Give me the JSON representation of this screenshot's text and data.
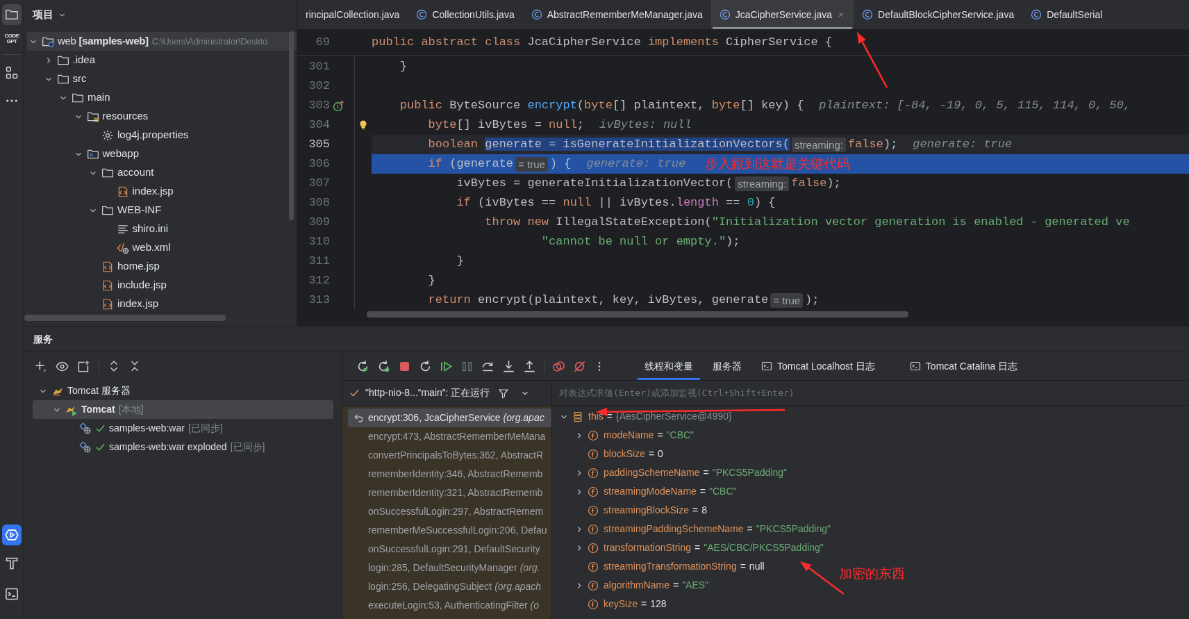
{
  "project": {
    "title": "项目",
    "tree": [
      {
        "label": "web **[samples-web]**",
        "path": "C:\\Users\\Administrator\\Deskto",
        "kind": "module",
        "expanded": true,
        "selected": true,
        "children": [
          {
            "label": ".idea",
            "kind": "folder",
            "expanded": false,
            "selected": false
          },
          {
            "label": "src",
            "kind": "folder",
            "expanded": true,
            "selected": false,
            "children": [
              {
                "label": "main",
                "kind": "folder",
                "expanded": true,
                "selected": false,
                "children": [
                  {
                    "label": "resources",
                    "kind": "resources",
                    "expanded": true,
                    "selected": false,
                    "children": [
                      {
                        "label": "log4j.properties",
                        "kind": "properties",
                        "selected": false
                      }
                    ]
                  },
                  {
                    "label": "webapp",
                    "kind": "webapp",
                    "expanded": true,
                    "selected": false,
                    "children": [
                      {
                        "label": "account",
                        "kind": "folder",
                        "expanded": true,
                        "selected": false,
                        "children": [
                          {
                            "label": "index.jsp",
                            "kind": "jsp",
                            "selected": false
                          }
                        ]
                      },
                      {
                        "label": "WEB-INF",
                        "kind": "folder",
                        "expanded": true,
                        "selected": false,
                        "children": [
                          {
                            "label": "shiro.ini",
                            "kind": "text",
                            "selected": false
                          },
                          {
                            "label": "web.xml",
                            "kind": "xml",
                            "selected": false
                          }
                        ]
                      },
                      {
                        "label": "home.jsp",
                        "kind": "jsp",
                        "selected": false
                      },
                      {
                        "label": "include.jsp",
                        "kind": "jsp",
                        "selected": false
                      },
                      {
                        "label": "index.jsp",
                        "kind": "jsp",
                        "selected": false
                      }
                    ]
                  }
                ]
              }
            ]
          }
        ]
      }
    ]
  },
  "editor": {
    "tabs": [
      {
        "label": "rincipalCollection.java",
        "icon": false,
        "selected": false
      },
      {
        "label": "CollectionUtils.java",
        "icon": true,
        "selected": false
      },
      {
        "label": "AbstractRememberMeManager.java",
        "icon": true,
        "selected": false
      },
      {
        "label": "JcaCipherService.java",
        "icon": true,
        "selected": true
      },
      {
        "label": "DefaultBlockCipherService.java",
        "icon": true,
        "selected": false
      },
      {
        "label": "DefaultSerial",
        "icon": true,
        "selected": false
      }
    ],
    "sticky_line": {
      "number": "69",
      "tokens": [
        {
          "kind": "kw",
          "text": "public abstract class "
        },
        {
          "kind": "plain",
          "text": "JcaCipherService "
        },
        {
          "kind": "kw",
          "text": "implements "
        },
        {
          "kind": "plain",
          "text": "CipherService {"
        }
      ]
    },
    "lines": [
      {
        "number": "301",
        "kind": "plain",
        "caret": false,
        "execution_point": false,
        "tokens": [
          {
            "kind": "plain",
            "text": "    }"
          }
        ]
      },
      {
        "number": "302",
        "kind": "plain",
        "caret": false,
        "execution_point": false
      },
      {
        "number": "303",
        "kind": "override",
        "caret": false,
        "execution_point": false,
        "tokens": [
          {
            "kind": "kw",
            "text": "    public "
          },
          {
            "kind": "plain",
            "text": "ByteSource "
          },
          {
            "kind": "method",
            "text": "encrypt"
          },
          {
            "kind": "plain",
            "text": "("
          },
          {
            "kind": "kw",
            "text": "byte"
          },
          {
            "kind": "plain",
            "text": "[] plaintext, "
          },
          {
            "kind": "kw",
            "text": "byte"
          },
          {
            "kind": "plain",
            "text": "[] key) {"
          },
          {
            "kind": "hint",
            "text": "plaintext: [-84, -19, 0, 5, 115, 114, 0, 50,"
          }
        ]
      },
      {
        "number": "304",
        "kind": "bulb",
        "caret": false,
        "execution_point": false,
        "tokens": [
          {
            "kind": "kw",
            "text": "        byte"
          },
          {
            "kind": "plain",
            "text": "[] ivBytes = "
          },
          {
            "kind": "kw",
            "text": "null"
          },
          {
            "kind": "plain",
            "text": ";"
          },
          {
            "kind": "hint",
            "text": "ivBytes: null"
          }
        ]
      },
      {
        "number": "305",
        "kind": "plain",
        "caret": true,
        "execution_point": false,
        "tokens": [
          {
            "kind": "kw",
            "text": "        boolean "
          },
          {
            "kind": "selected",
            "text": "generate = isGenerateInitializationVectors("
          },
          {
            "kind": "inlay",
            "text": "streaming:"
          },
          {
            "kind": "kw",
            "text": "false"
          },
          {
            "kind": "plain",
            "text": ");"
          },
          {
            "kind": "hint",
            "text": "generate: true"
          }
        ]
      },
      {
        "number": "306",
        "kind": "plain",
        "caret": false,
        "execution_point": true,
        "tokens": [
          {
            "kind": "kw",
            "text": "        if "
          },
          {
            "kind": "plain",
            "text": "(generate"
          },
          {
            "kind": "inlay",
            "text": "= true"
          },
          {
            "kind": "plain",
            "text": ") {"
          },
          {
            "kind": "hint",
            "text": "generate: true"
          },
          {
            "kind": "annotation",
            "text": "步入跟到这就是关键代码"
          }
        ]
      },
      {
        "number": "307",
        "kind": "plain",
        "caret": false,
        "execution_point": false,
        "tokens": [
          {
            "kind": "plain",
            "text": "            ivBytes = generateInitializationVector("
          },
          {
            "kind": "inlay",
            "text": "streaming:"
          },
          {
            "kind": "kw",
            "text": "false"
          },
          {
            "kind": "plain",
            "text": ");"
          }
        ]
      },
      {
        "number": "308",
        "kind": "plain",
        "caret": false,
        "execution_point": false,
        "tokens": [
          {
            "kind": "kw",
            "text": "            if "
          },
          {
            "kind": "plain",
            "text": "(ivBytes == "
          },
          {
            "kind": "kw",
            "text": "null"
          },
          {
            "kind": "plain",
            "text": " || ivBytes."
          },
          {
            "kind": "field",
            "text": "length"
          },
          {
            "kind": "plain",
            "text": " == "
          },
          {
            "kind": "number",
            "text": "0"
          },
          {
            "kind": "plain",
            "text": ") {"
          }
        ]
      },
      {
        "number": "309",
        "kind": "plain",
        "caret": false,
        "execution_point": false,
        "tokens": [
          {
            "kind": "kw",
            "text": "                throw new "
          },
          {
            "kind": "plain",
            "text": "IllegalStateException("
          },
          {
            "kind": "string",
            "text": "\"Initialization vector generation is enabled - generated ve"
          }
        ]
      },
      {
        "number": "310",
        "kind": "plain",
        "caret": false,
        "execution_point": false,
        "tokens": [
          {
            "kind": "string",
            "text": "                        \"cannot be null or empty.\""
          },
          {
            "kind": "plain",
            "text": ");"
          }
        ]
      },
      {
        "number": "311",
        "kind": "plain",
        "caret": false,
        "execution_point": false,
        "tokens": [
          {
            "kind": "plain",
            "text": "            }"
          }
        ]
      },
      {
        "number": "312",
        "kind": "plain",
        "caret": false,
        "execution_point": false,
        "tokens": [
          {
            "kind": "plain",
            "text": "        }"
          }
        ]
      },
      {
        "number": "313",
        "kind": "plain",
        "caret": false,
        "execution_point": false,
        "tokens": [
          {
            "kind": "kw",
            "text": "        return "
          },
          {
            "kind": "plain",
            "text": "encrypt(plaintext, key, ivBytes, generate"
          },
          {
            "kind": "inlay",
            "text": "= true"
          },
          {
            "kind": "plain",
            "text": ");"
          }
        ]
      }
    ]
  },
  "services": {
    "title": "服务",
    "tree": [
      {
        "label": "Tomcat 服务器",
        "kind": "server",
        "expanded": true,
        "selected": false,
        "children": [
          {
            "label": "Tomcat",
            "note": "[本地]",
            "kind": "server_running",
            "expanded": true,
            "selected": true,
            "children": [
              {
                "label": "samples-web:war",
                "note": "[已同步]",
                "kind": "artifact",
                "selected": false
              },
              {
                "label": "samples-web:war exploded",
                "note": "[已同步]",
                "kind": "artifact",
                "selected": false
              }
            ]
          }
        ]
      }
    ]
  },
  "debugger": {
    "tabs": [
      {
        "label": "线程和变量",
        "icon": false,
        "selected": true
      },
      {
        "label": "服务器",
        "icon": false,
        "selected": false
      },
      {
        "label": "Tomcat Localhost 日志",
        "icon": true,
        "selected": false
      },
      {
        "label": "Tomcat Catalina 日志",
        "icon": true,
        "selected": false
      }
    ],
    "thread": "\"http-nio-8...“main”: 正在运行",
    "frames": [
      {
        "text": "encrypt:306, JcaCipherService *(org.apac*",
        "current": true,
        "selected": true
      },
      {
        "text": "encrypt:473, AbstractRememberMeMana",
        "current": false,
        "selected": false
      },
      {
        "text": "convertPrincipalsToBytes:362, AbstractR",
        "current": false,
        "selected": false
      },
      {
        "text": "rememberIdentity:346, AbstractRememb",
        "current": false,
        "selected": false
      },
      {
        "text": "rememberIdentity:321, AbstractRememb",
        "current": false,
        "selected": false
      },
      {
        "text": "onSuccessfulLogin:297, AbstractRemem",
        "current": false,
        "selected": false
      },
      {
        "text": "rememberMeSuccessfulLogin:206, Defau",
        "current": false,
        "selected": false
      },
      {
        "text": "onSuccessfulLogin:291, DefaultSecurity",
        "current": false,
        "selected": false
      },
      {
        "text": "login:285, DefaultSecurityManager *(org.*",
        "current": false,
        "selected": false
      },
      {
        "text": "login:256, DelegatingSubject *(org.apach*",
        "current": false,
        "selected": false
      },
      {
        "text": "executeLogin:53, AuthenticatingFilter *(o*",
        "current": false,
        "selected": false
      }
    ],
    "eval_placeholder": "对表达式求值(Enter)或添加监视(Ctrl+Shift+Enter)",
    "variables": [
      {
        "name": "this",
        "sign": "=",
        "value": "{AesCipherService@4990}",
        "kind": "object",
        "expanded": true,
        "children": [
          {
            "name": "modeName",
            "sign": "=",
            "value": "\"CBC\"",
            "kind": "string_field",
            "expanded": false
          },
          {
            "name": "blockSize",
            "sign": "=",
            "value": "0",
            "kind": "value_field"
          },
          {
            "name": "paddingSchemeName",
            "sign": "=",
            "value": "\"PKCS5Padding\"",
            "kind": "string_field",
            "expanded": false
          },
          {
            "name": "streamingModeName",
            "sign": "=",
            "value": "\"CBC\"",
            "kind": "string_field",
            "expanded": false
          },
          {
            "name": "streamingBlockSize",
            "sign": "=",
            "value": "8",
            "kind": "value_field"
          },
          {
            "name": "streamingPaddingSchemeName",
            "sign": "=",
            "value": "\"PKCS5Padding\"",
            "kind": "string_field",
            "expanded": false
          },
          {
            "name": "transformationString",
            "sign": "=",
            "value": "\"AES/CBC/PKCS5Padding\"",
            "kind": "string_field",
            "expanded": false
          },
          {
            "name": "streamingTransformationString",
            "sign": "=",
            "value": "null",
            "kind": "value_field"
          },
          {
            "name": "algorithmName",
            "sign": "=",
            "value": "\"AES\"",
            "kind": "string_field",
            "expanded": false
          },
          {
            "name": "keySize",
            "sign": "=",
            "value": "128",
            "kind": "value_field"
          }
        ]
      }
    ],
    "annotation": "加密的东西"
  },
  "sidebar": {
    "logo": "CODE GPT"
  }
}
